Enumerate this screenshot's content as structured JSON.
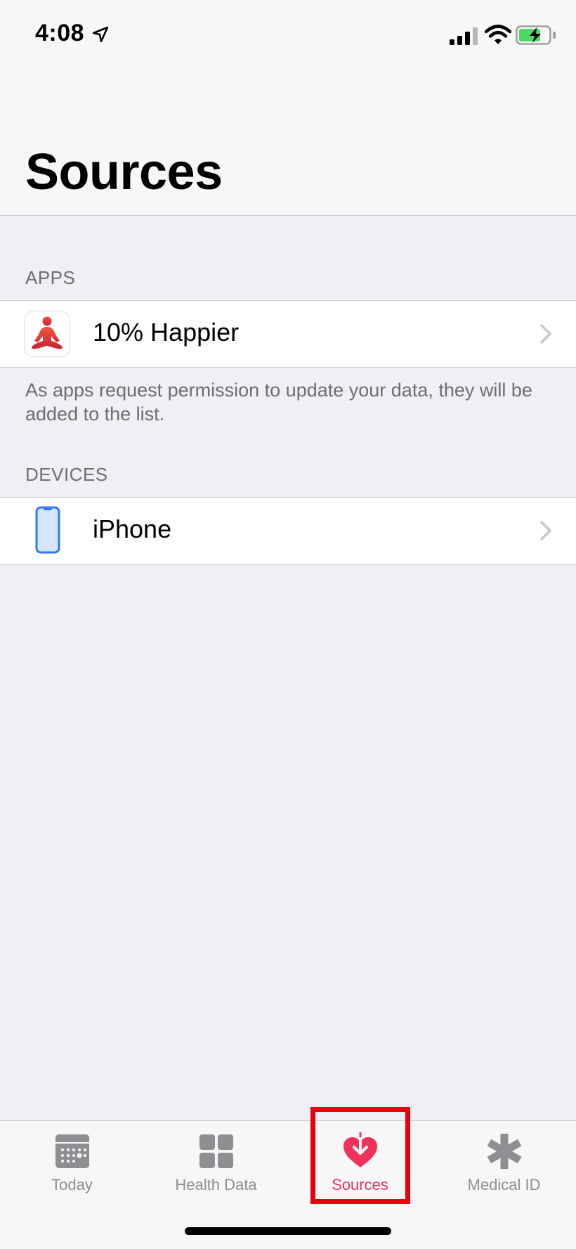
{
  "status_bar": {
    "time": "4:08",
    "icons": [
      "location-arrow-icon",
      "cellular-signal-icon",
      "wifi-icon",
      "battery-charging-icon"
    ]
  },
  "header": {
    "title": "Sources"
  },
  "apps_section": {
    "header": "APPS",
    "items": [
      {
        "label": "10% Happier",
        "icon": "meditation-figure-icon"
      }
    ],
    "footer": "As apps request permission to update your data, they will be added to the list."
  },
  "devices_section": {
    "header": "DEVICES",
    "items": [
      {
        "label": "iPhone",
        "icon": "iphone-icon"
      }
    ]
  },
  "tab_bar": {
    "tabs": [
      {
        "label": "Today",
        "icon": "calendar-icon"
      },
      {
        "label": "Health Data",
        "icon": "grid-icon"
      },
      {
        "label": "Sources",
        "icon": "heart-download-icon"
      },
      {
        "label": "Medical ID",
        "icon": "asterisk-icon"
      }
    ],
    "active": "Sources"
  },
  "colors": {
    "accent": "#f0325a",
    "inactive": "#8e8e93",
    "highlight": "#e8000b",
    "background": "#efeff4"
  }
}
